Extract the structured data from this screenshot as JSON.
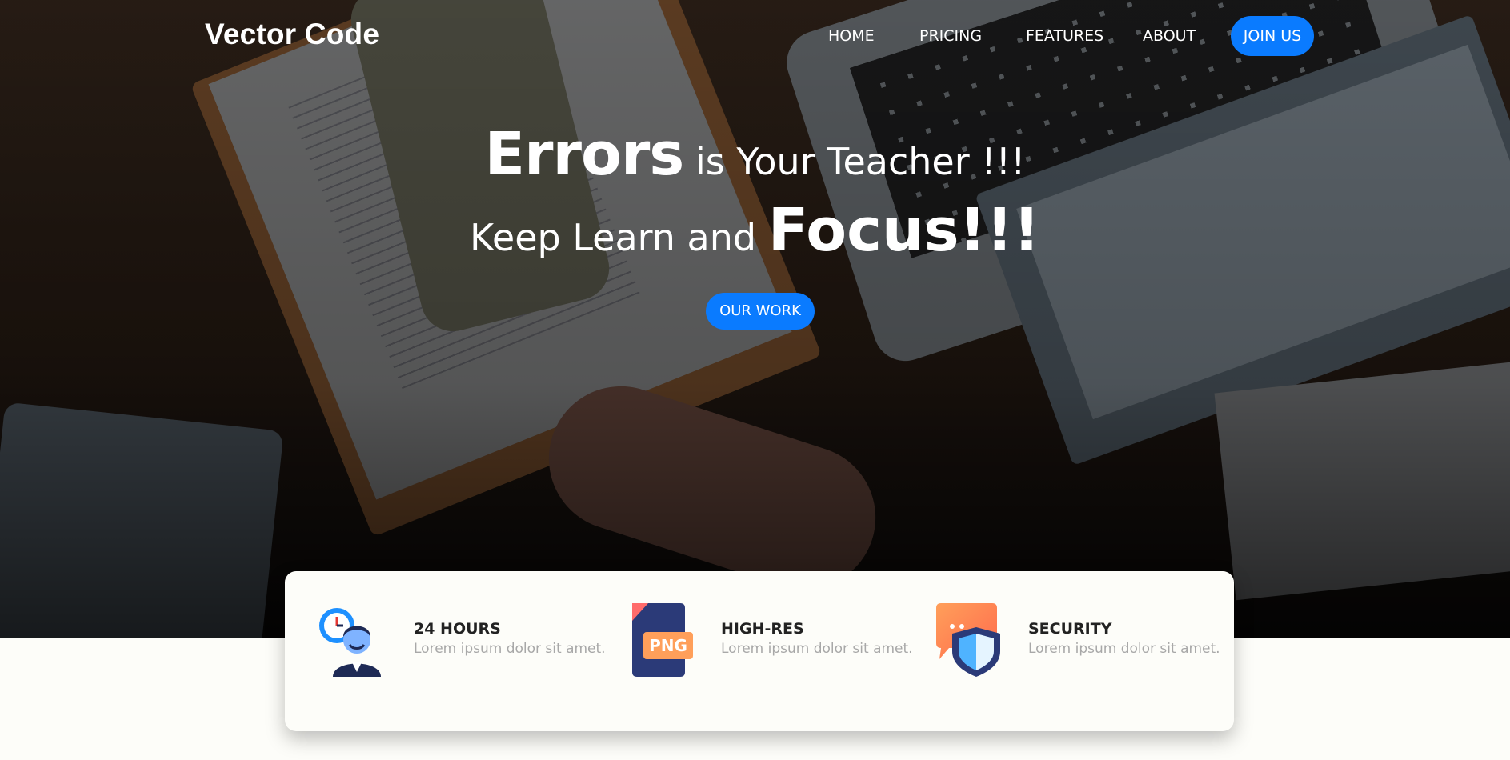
{
  "brand": {
    "name": "Vector Code"
  },
  "nav": {
    "items": [
      "HOME",
      "PRICING",
      "FEATURES",
      "ABOUT"
    ],
    "join_label": "JOIN US"
  },
  "hero": {
    "line1_big": "Errors",
    "line1_small": " is Your Teacher !!!",
    "line2_small": "Keep Learn and ",
    "line2_big": "Focus!!!",
    "cta_label": "OUR WORK"
  },
  "features": [
    {
      "title": "24 HOURS",
      "desc": "Lorem ipsum dolor sit amet.",
      "icon": "support-agent-clock-icon"
    },
    {
      "title": "HIGH-RES",
      "desc": "Lorem ipsum dolor sit amet.",
      "icon": "png-file-icon",
      "icon_text": "PNG"
    },
    {
      "title": "SECURITY",
      "desc": "Lorem ipsum dolor sit amet.",
      "icon": "chat-shield-icon"
    }
  ],
  "colors": {
    "accent": "#0a7bff",
    "card_bg": "#fdfdf9",
    "muted_text": "#a8a8a8"
  }
}
